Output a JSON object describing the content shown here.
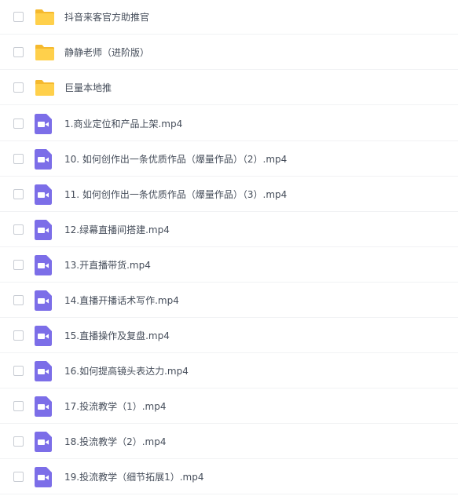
{
  "files": [
    {
      "name": "抖音来客官方助推官",
      "type": "folder",
      "icon": "folder-icon"
    },
    {
      "name": "静静老师（进阶版）",
      "type": "folder",
      "icon": "folder-icon"
    },
    {
      "name": "巨量本地推",
      "type": "folder",
      "icon": "folder-icon"
    },
    {
      "name": "1.商业定位和产品上架.mp4",
      "type": "video",
      "icon": "video-file-icon"
    },
    {
      "name": "10. 如何创作出一条优质作品（爆量作品）（2）.mp4",
      "type": "video",
      "icon": "video-file-icon"
    },
    {
      "name": "11. 如何创作出一条优质作品（爆量作品）（3）.mp4",
      "type": "video",
      "icon": "video-file-icon"
    },
    {
      "name": "12.绿幕直播间搭建.mp4",
      "type": "video",
      "icon": "video-file-icon"
    },
    {
      "name": "13.开直播带货.mp4",
      "type": "video",
      "icon": "video-file-icon"
    },
    {
      "name": "14.直播开播话术写作.mp4",
      "type": "video",
      "icon": "video-file-icon"
    },
    {
      "name": "15.直播操作及复盘.mp4",
      "type": "video",
      "icon": "video-file-icon"
    },
    {
      "name": "16.如何提高镜头表达力.mp4",
      "type": "video",
      "icon": "video-file-icon"
    },
    {
      "name": "17.投流教学（1）.mp4",
      "type": "video",
      "icon": "video-file-icon"
    },
    {
      "name": "18.投流教学（2）.mp4",
      "type": "video",
      "icon": "video-file-icon"
    },
    {
      "name": "19.投流教学（细节拓展1）.mp4",
      "type": "video",
      "icon": "video-file-icon"
    }
  ],
  "colors": {
    "folder": "#ffd04b",
    "folder_tab": "#f5b92e",
    "video": "#7c6ee8",
    "video_symbol": "#ffffff",
    "text": "#454d5a",
    "checkbox_border": "#c8ccd3",
    "divider": "#f1f2f4"
  }
}
